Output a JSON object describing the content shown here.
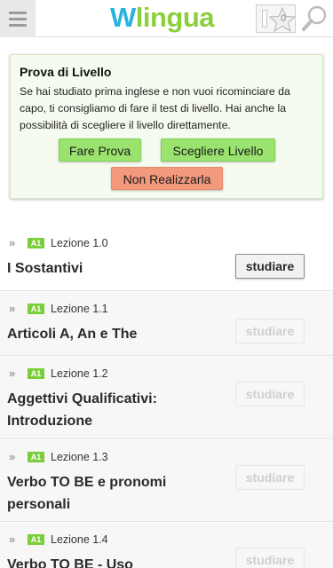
{
  "header": {
    "logo_first": "W",
    "logo_rest": "lingua",
    "star_count": "0",
    "colors": {
      "logo_blue": "#2ab3e0",
      "logo_green": "#8ccf3c"
    }
  },
  "level_test": {
    "title": "Prova di Livello",
    "text": "Se hai studiato prima inglese e non vuoi ricominciare da capo, ti consigliamo di fare il test di livello. Hai anche la possibilità di scegliere il livello direttamente.",
    "buttons": {
      "take_test": "Fare Prova",
      "choose_level": "Scegliere Livello",
      "skip": "Non Realizzarla"
    }
  },
  "lessons": [
    {
      "level": "A1",
      "number": "Lezione 1.0",
      "title": "I Sostantivi",
      "action": "studiare"
    },
    {
      "level": "A1",
      "number": "Lezione 1.1",
      "title": "Articoli A, An e The",
      "action": "studiare"
    },
    {
      "level": "A1",
      "number": "Lezione 1.2",
      "title": "Aggettivi Qualificativi: Introduzione",
      "action": "studiare"
    },
    {
      "level": "A1",
      "number": "Lezione 1.3",
      "title": "Verbo TO BE e pronomi personali",
      "action": "studiare"
    },
    {
      "level": "A1",
      "number": "Lezione 1.4",
      "title": "Verbo TO BE - Uso",
      "action": "studiare"
    }
  ]
}
